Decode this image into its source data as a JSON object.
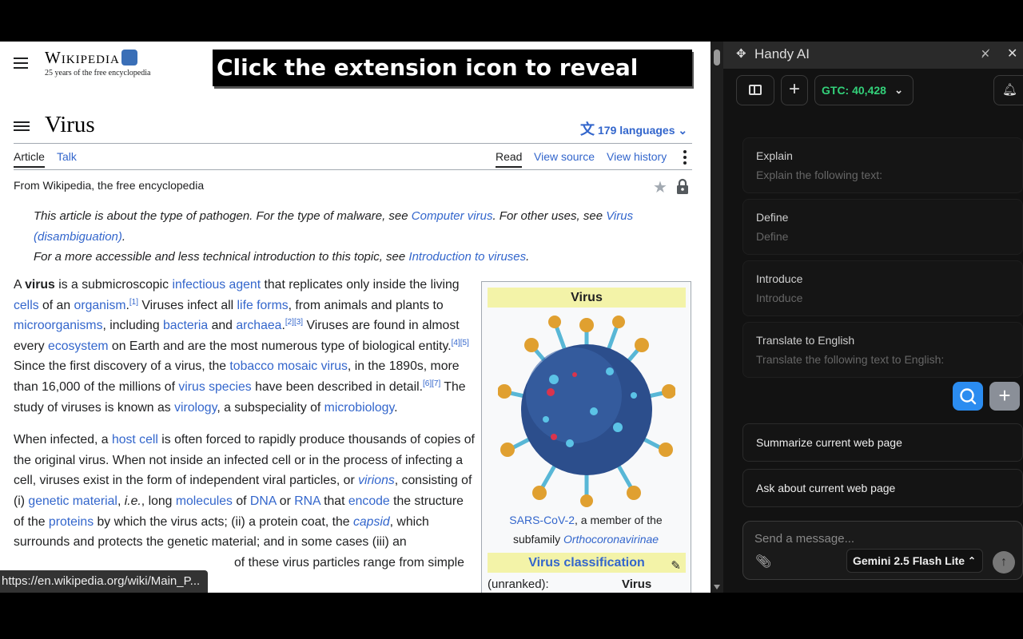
{
  "wiki": {
    "logo_wordmark": "Wikipedia",
    "logo_tagline": "25 years of the free encyclopedia",
    "banner": "Click the extension icon to reveal side Chat",
    "title": "Virus",
    "languages": "179 languages",
    "tabs": {
      "article": "Article",
      "talk": "Talk",
      "read": "Read",
      "view_source": "View source",
      "view_history": "View history"
    },
    "from": "From Wikipedia, the free encyclopedia",
    "hatnote1": {
      "a": "This article is about the type of pathogen. For the type of malware, see ",
      "link1": "Computer virus",
      "b": ". For other uses, see ",
      "link2": "Virus (disambiguation)",
      "c": "."
    },
    "hatnote2": {
      "a": "For a more accessible and less technical introduction to this topic, see ",
      "link": "Introduction to viruses",
      "b": "."
    },
    "p1": {
      "t1": "A ",
      "bold": "virus",
      "t2": " is a submicroscopic ",
      "l1": "infectious agent",
      "t3": " that replicates only inside the living ",
      "l2": "cells",
      "t4": " of an ",
      "l3": "organism",
      "t5": ".",
      "s1": "[1]",
      "t6": " Viruses infect all ",
      "l4": "life forms",
      "t7": ", from animals and plants to ",
      "l5": "microorganisms",
      "t8": ", including ",
      "l6": "bacteria",
      "t9": " and ",
      "l7": "archaea",
      "t10": ".",
      "s2": "[2][3]",
      "t11": " Viruses are found in almost every ",
      "l8": "ecosystem",
      "t12": " on Earth and are the most numerous type of biological entity.",
      "s3": "[4][5]",
      "t13": " Since the first discovery of a virus, the ",
      "l9": "tobacco mosaic virus",
      "t14": ", in the 1890s, more than 16,000 of the millions of ",
      "l10": "virus species",
      "t15": " have been described in detail.",
      "s4": "[6][7]",
      "t16": " The study of viruses is known as ",
      "l11": "virology",
      "t17": ", a subspeciality of ",
      "l12": "microbiology",
      "t18": "."
    },
    "p2": {
      "t1": "When infected, a ",
      "l1": "host cell",
      "t2": " is often forced to rapidly produce thousands of copies of the original virus. When not inside an infected cell or in the process of infecting a cell, viruses exist in the form of independent viral particles, or ",
      "l2": "virions",
      "t3": ", consisting of (i) ",
      "l3": "genetic material",
      "t4": ", ",
      "ie": "i.e.",
      "t5": ", long ",
      "l4": "molecules",
      "t6": " of ",
      "l5": "DNA",
      "t7": " or ",
      "l6": "RNA",
      "t8": " that ",
      "l7": "encode",
      "t9": " the structure of the ",
      "l8": "proteins",
      "t10": " by which the virus acts; (ii) a protein coat, the ",
      "l9": "capsid",
      "t11": ", which surrounds and protects the genetic material; and in some cases (iii) an",
      "t12": " of these virus particles range from simple"
    },
    "infobox": {
      "title": "Virus",
      "caption_link": "SARS-CoV-2",
      "caption_text": ", a member of the subfamily ",
      "caption_italic": "Orthocoronavirinae",
      "classification": "Virus classification",
      "rank_label": "(unranked):",
      "rank_value": "Virus"
    },
    "status_url": "https://en.wikipedia.org/wiki/Main_P..."
  },
  "panel": {
    "title": "Handy AI",
    "gtc": "GTC: 40,428",
    "prompts": [
      {
        "title": "Explain",
        "desc": "Explain the following text:"
      },
      {
        "title": "Define",
        "desc": "Define"
      },
      {
        "title": "Introduce",
        "desc": "Introduce"
      },
      {
        "title": "Translate to English",
        "desc": "Translate the following text to English:"
      }
    ],
    "quick_actions": [
      "Summarize current web page",
      "Ask about current web page"
    ],
    "composer_placeholder": "Send a message...",
    "model": "Gemini 2.5 Flash Lite"
  },
  "colors": {
    "link": "#3366cc",
    "gtc_green": "#33d17a",
    "search_blue": "#2b8cf0",
    "infobox_header": "#f3f3a8"
  },
  "icons": [
    "hamburger-menu-icon",
    "toc-icon",
    "translate-icon",
    "star-icon",
    "lock-icon",
    "edit-pencil-icon",
    "handy-logo-icon",
    "unpin-icon",
    "close-icon",
    "sidebar-toggle-icon",
    "plus-icon",
    "chevron-down-icon",
    "bell-icon",
    "search-icon",
    "paperclip-icon",
    "send-arrow-icon"
  ]
}
